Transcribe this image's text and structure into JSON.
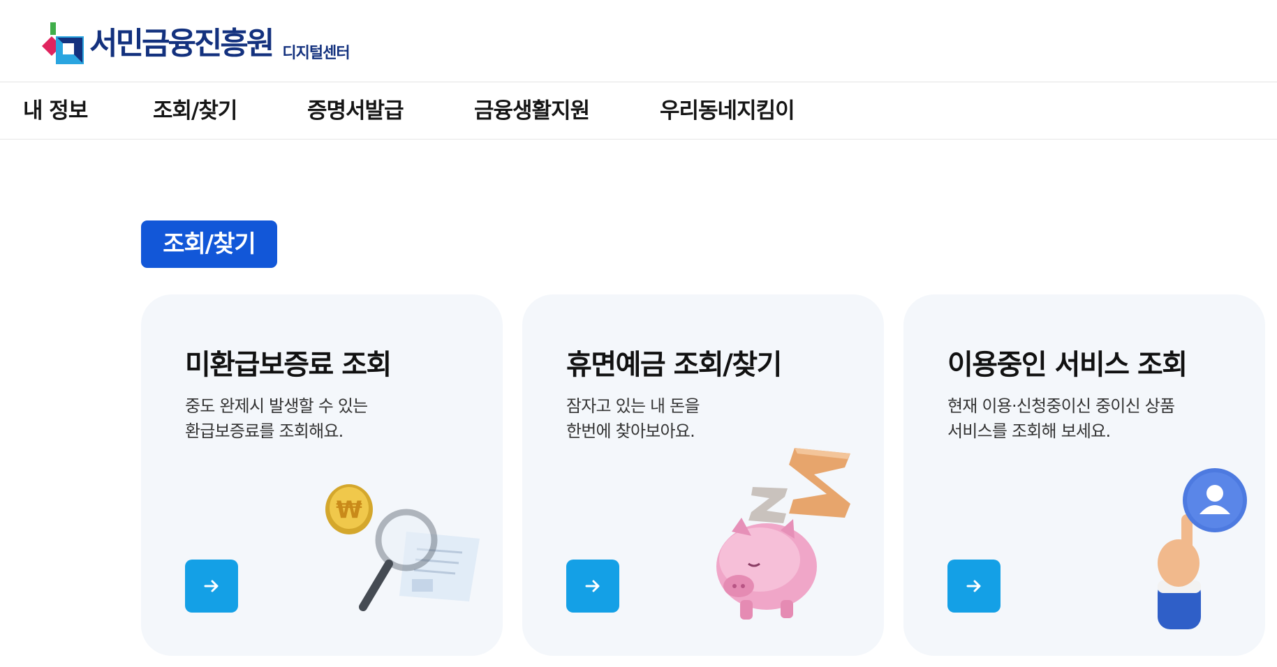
{
  "header": {
    "logo_name": "서민금융진흥원",
    "logo_sub": "디지털센터"
  },
  "nav": {
    "items": [
      {
        "label": "내 정보"
      },
      {
        "label": "조회/찾기"
      },
      {
        "label": "증명서발급"
      },
      {
        "label": "금융생활지원"
      },
      {
        "label": "우리동네지킴이"
      }
    ]
  },
  "section": {
    "title": "조회/찾기"
  },
  "cards": [
    {
      "title": "미환급보증료 조회",
      "desc": [
        "중도 완제시 발생할 수 있는",
        "환급보증료를 조회해요."
      ],
      "icon": "magnifier-coin-illustration"
    },
    {
      "title": "휴면예금 조회/찾기",
      "desc": [
        "잠자고 있는 내 돈을",
        "한번에 찾아보아요."
      ],
      "icon": "sleeping-piggy-bank-illustration"
    },
    {
      "title": "이용중인 서비스 조회",
      "desc": [
        "현재 이용·신청중이신 중이신 상품",
        "서비스를 조회해 보세요."
      ],
      "icon": "hand-touch-user-illustration"
    }
  ],
  "colors": {
    "brand_navy": "#13317e",
    "accent_blue": "#1257d8",
    "button_blue": "#14a0e6",
    "card_bg": "#f4f7fb"
  }
}
